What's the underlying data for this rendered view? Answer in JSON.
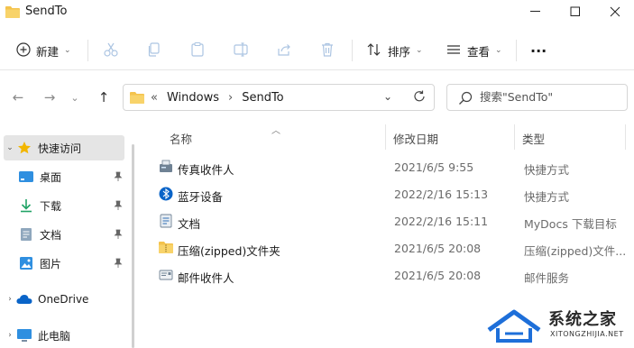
{
  "window": {
    "title": "SendTo",
    "controls": {
      "minimize": "—",
      "maximize": "☐",
      "close": "✕"
    }
  },
  "toolbar": {
    "new_label": "新建",
    "sort_label": "排序",
    "view_label": "查看",
    "more_label": "···",
    "icons": [
      "cut-icon",
      "copy-icon",
      "paste-icon",
      "rename-icon",
      "share-icon",
      "delete-icon"
    ]
  },
  "navigation": {
    "back": "←",
    "forward": "→",
    "recent": "⌄",
    "up": "↑",
    "address": {
      "overflow": "«",
      "parts": [
        "Windows",
        "SendTo"
      ],
      "separator": "›"
    },
    "search_placeholder": "搜索\"SendTo\""
  },
  "sidebar": {
    "items": [
      {
        "label": "快速访问",
        "expanded": true,
        "icon": "star-icon",
        "active": true
      },
      {
        "label": "桌面",
        "icon": "desktop-icon",
        "pinned": true
      },
      {
        "label": "下载",
        "icon": "download-icon",
        "pinned": true
      },
      {
        "label": "文档",
        "icon": "document-icon",
        "pinned": true
      },
      {
        "label": "图片",
        "icon": "pictures-icon",
        "pinned": true
      },
      {
        "label": "OneDrive",
        "icon": "cloud-icon"
      },
      {
        "label": "此电脑",
        "icon": "computer-icon"
      }
    ]
  },
  "file_list": {
    "columns": [
      "名称",
      "修改日期",
      "类型"
    ],
    "rows": [
      {
        "name": "传真收件人",
        "date": "2021/6/5 9:55",
        "type": "快捷方式",
        "icon": "fax-icon"
      },
      {
        "name": "蓝牙设备",
        "date": "2022/2/16 15:13",
        "type": "快捷方式",
        "icon": "bluetooth-icon"
      },
      {
        "name": "文档",
        "date": "2022/2/16 15:11",
        "type": "MyDocs 下载目标",
        "icon": "mydocs-icon"
      },
      {
        "name": "压缩(zipped)文件夹",
        "date": "2021/6/5 20:08",
        "type": "压缩(zipped)文件...",
        "icon": "zip-folder-icon"
      },
      {
        "name": "邮件收件人",
        "date": "2021/6/5 20:08",
        "type": "邮件服务",
        "icon": "mail-icon"
      }
    ]
  },
  "watermark": {
    "text": "系统之家",
    "sub": "XITONGZHIJIA.NET"
  },
  "colors": {
    "folder": "#f4c34d",
    "accent": "#0a64c8",
    "selection": "#e5e5e5",
    "star": "#f2b600"
  }
}
